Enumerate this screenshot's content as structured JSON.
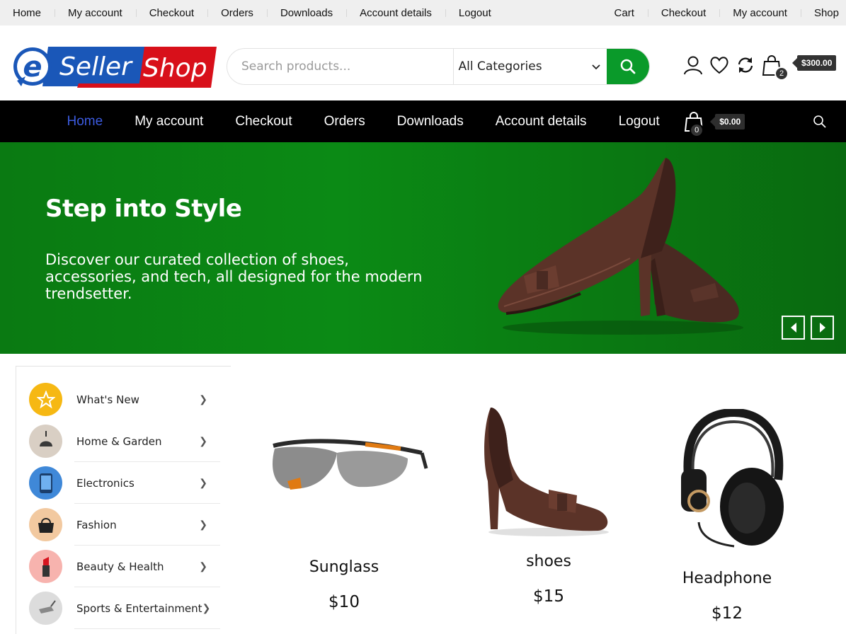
{
  "topbar": {
    "left": [
      "Home",
      "My account",
      "Checkout",
      "Orders",
      "Downloads",
      "Account details",
      "Logout"
    ],
    "right": [
      "Cart",
      "Checkout",
      "My account",
      "Shop"
    ]
  },
  "logo": {
    "part1": "Seller",
    "part2": "Shop",
    "mark": "e"
  },
  "search": {
    "placeholder": "Search products...",
    "category": "All Categories"
  },
  "header_icons": {
    "cart_count": "2",
    "cart_total": "$300.00"
  },
  "mainnav": {
    "items": [
      "Home",
      "My account",
      "Checkout",
      "Orders",
      "Downloads",
      "Account details",
      "Logout"
    ],
    "cart_count": "0",
    "cart_total": "$0.00"
  },
  "hero": {
    "title": "Step into Style",
    "text": "Discover our curated collection of shoes, accessories, and tech, all designed for the modern trendsetter."
  },
  "sidebar": {
    "items": [
      "What's New",
      "Home & Garden",
      "Electronics",
      "Fashion",
      "Beauty & Health",
      "Sports & Entertainment"
    ]
  },
  "products": [
    {
      "name": "Sunglass",
      "price": "$10"
    },
    {
      "name": "shoes",
      "price": "$15"
    },
    {
      "name": "Headphone",
      "price": "$12"
    }
  ],
  "colors": {
    "accent": "#0a9a2a",
    "hero": "#0b8a15",
    "nav_active": "#3c5be0",
    "logo_blue": "#1a57b8",
    "logo_red": "#d8101a"
  }
}
